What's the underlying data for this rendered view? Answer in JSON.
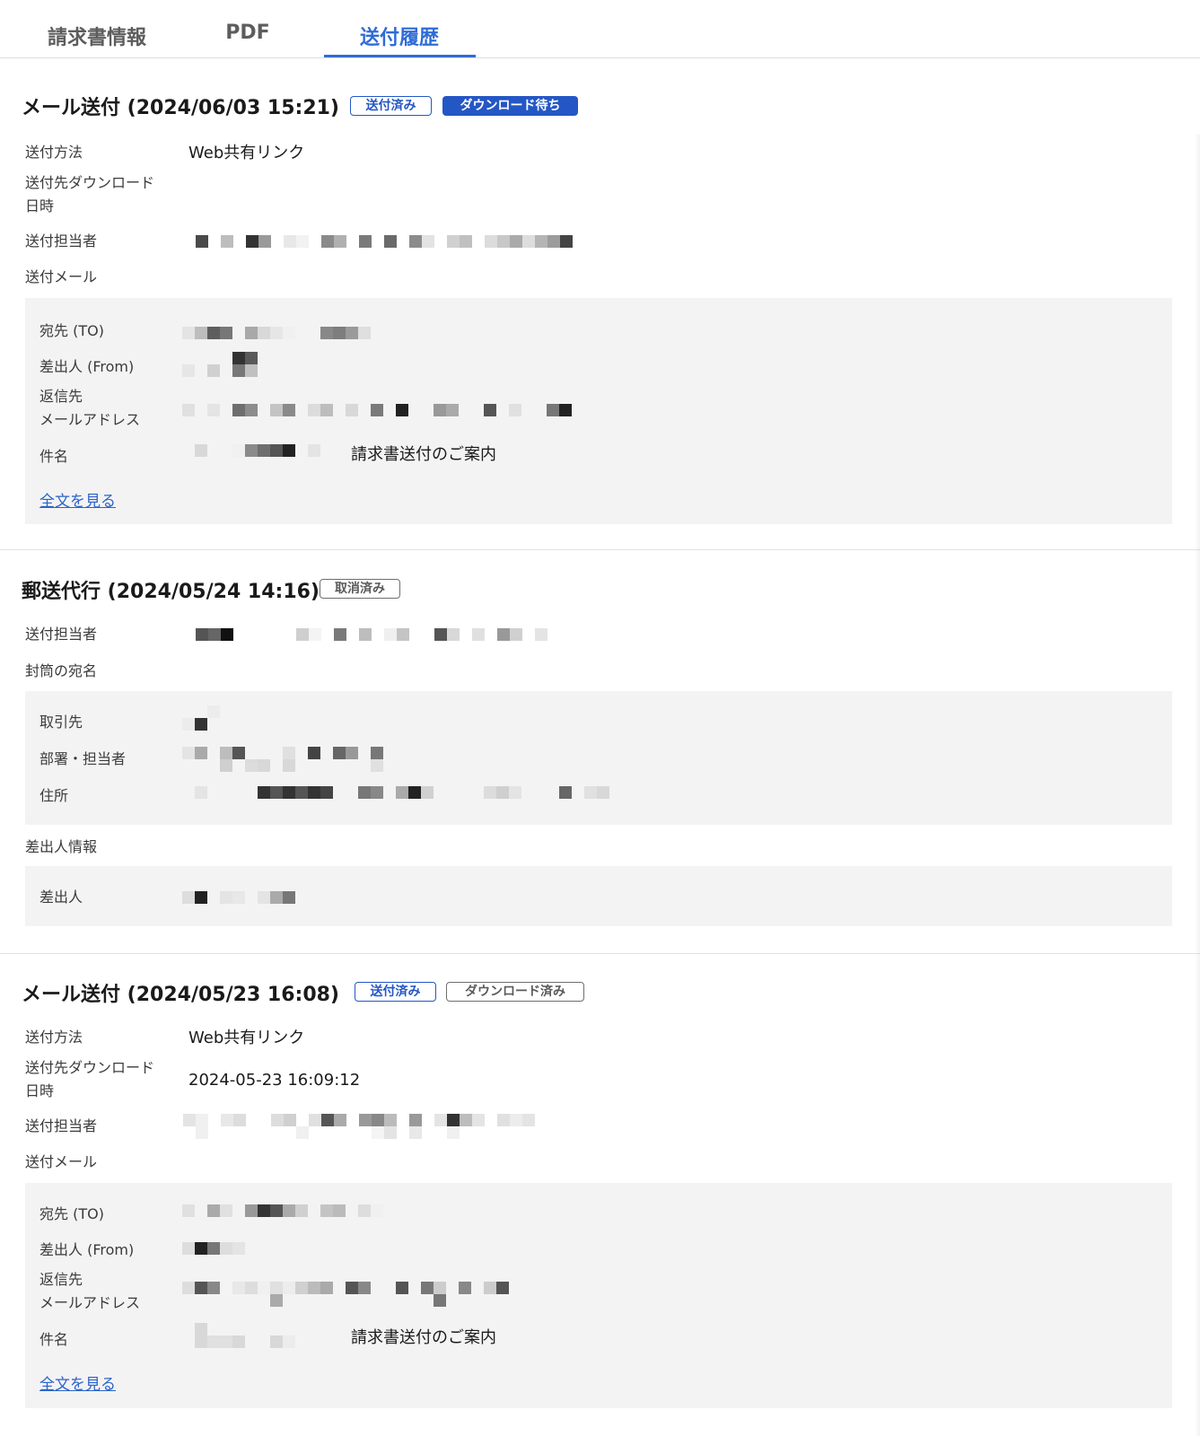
{
  "tabs": [
    {
      "label": "請求書情報"
    },
    {
      "label": "PDF"
    },
    {
      "label": "送付履歴"
    }
  ],
  "sections": [
    {
      "title": "メール送付 (2024/06/03 15:21)",
      "badges": [
        "送付済み",
        "ダウンロード待ち"
      ],
      "fields": {
        "method_label": "送付方法",
        "method_value": "Web共有リンク",
        "download_label": "送付先ダウンロード\n日時",
        "download_value": "",
        "sender_label": "送付担当者",
        "mail_label": "送付メール"
      },
      "mail": {
        "to_label": "宛先 (TO)",
        "from_label": "差出人 (From)",
        "reply_label": "返信先\nメールアドレス",
        "subject_label": "件名",
        "subject_value": "請求書送付のご案内",
        "link": "全文を見る"
      }
    },
    {
      "title": "郵送代行 (2024/05/24 14:16)",
      "badges": [
        "取消済み"
      ],
      "fields": {
        "sender_label": "送付担当者",
        "envelope_label": "封筒の宛名"
      },
      "envelope": {
        "partner_label": "取引先",
        "dept_label": "部署・担当者",
        "address_label": "住所"
      },
      "sender_info_label": "差出人情報",
      "sender_info": {
        "sender_label": "差出人"
      }
    },
    {
      "title": "メール送付 (2024/05/23 16:08)",
      "badges": [
        "送付済み",
        "ダウンロード済み"
      ],
      "fields": {
        "method_label": "送付方法",
        "method_value": "Web共有リンク",
        "download_label": "送付先ダウンロード\n日時",
        "download_value": "2024-05-23 16:09:12",
        "sender_label": "送付担当者",
        "mail_label": "送付メール"
      },
      "mail": {
        "to_label": "宛先 (TO)",
        "from_label": "差出人 (From)",
        "reply_label": "返信先\nメールアドレス",
        "subject_label": "件名",
        "subject_value": "請求書送付のご案内",
        "link": "全文を見る"
      }
    }
  ],
  "colors": {
    "accent": "#2f6cd6",
    "badge_blue": "#2457c5",
    "badge_gray": "#6e6e6e",
    "panel_bg": "#f4f3f4",
    "link": "#2a63c9"
  }
}
